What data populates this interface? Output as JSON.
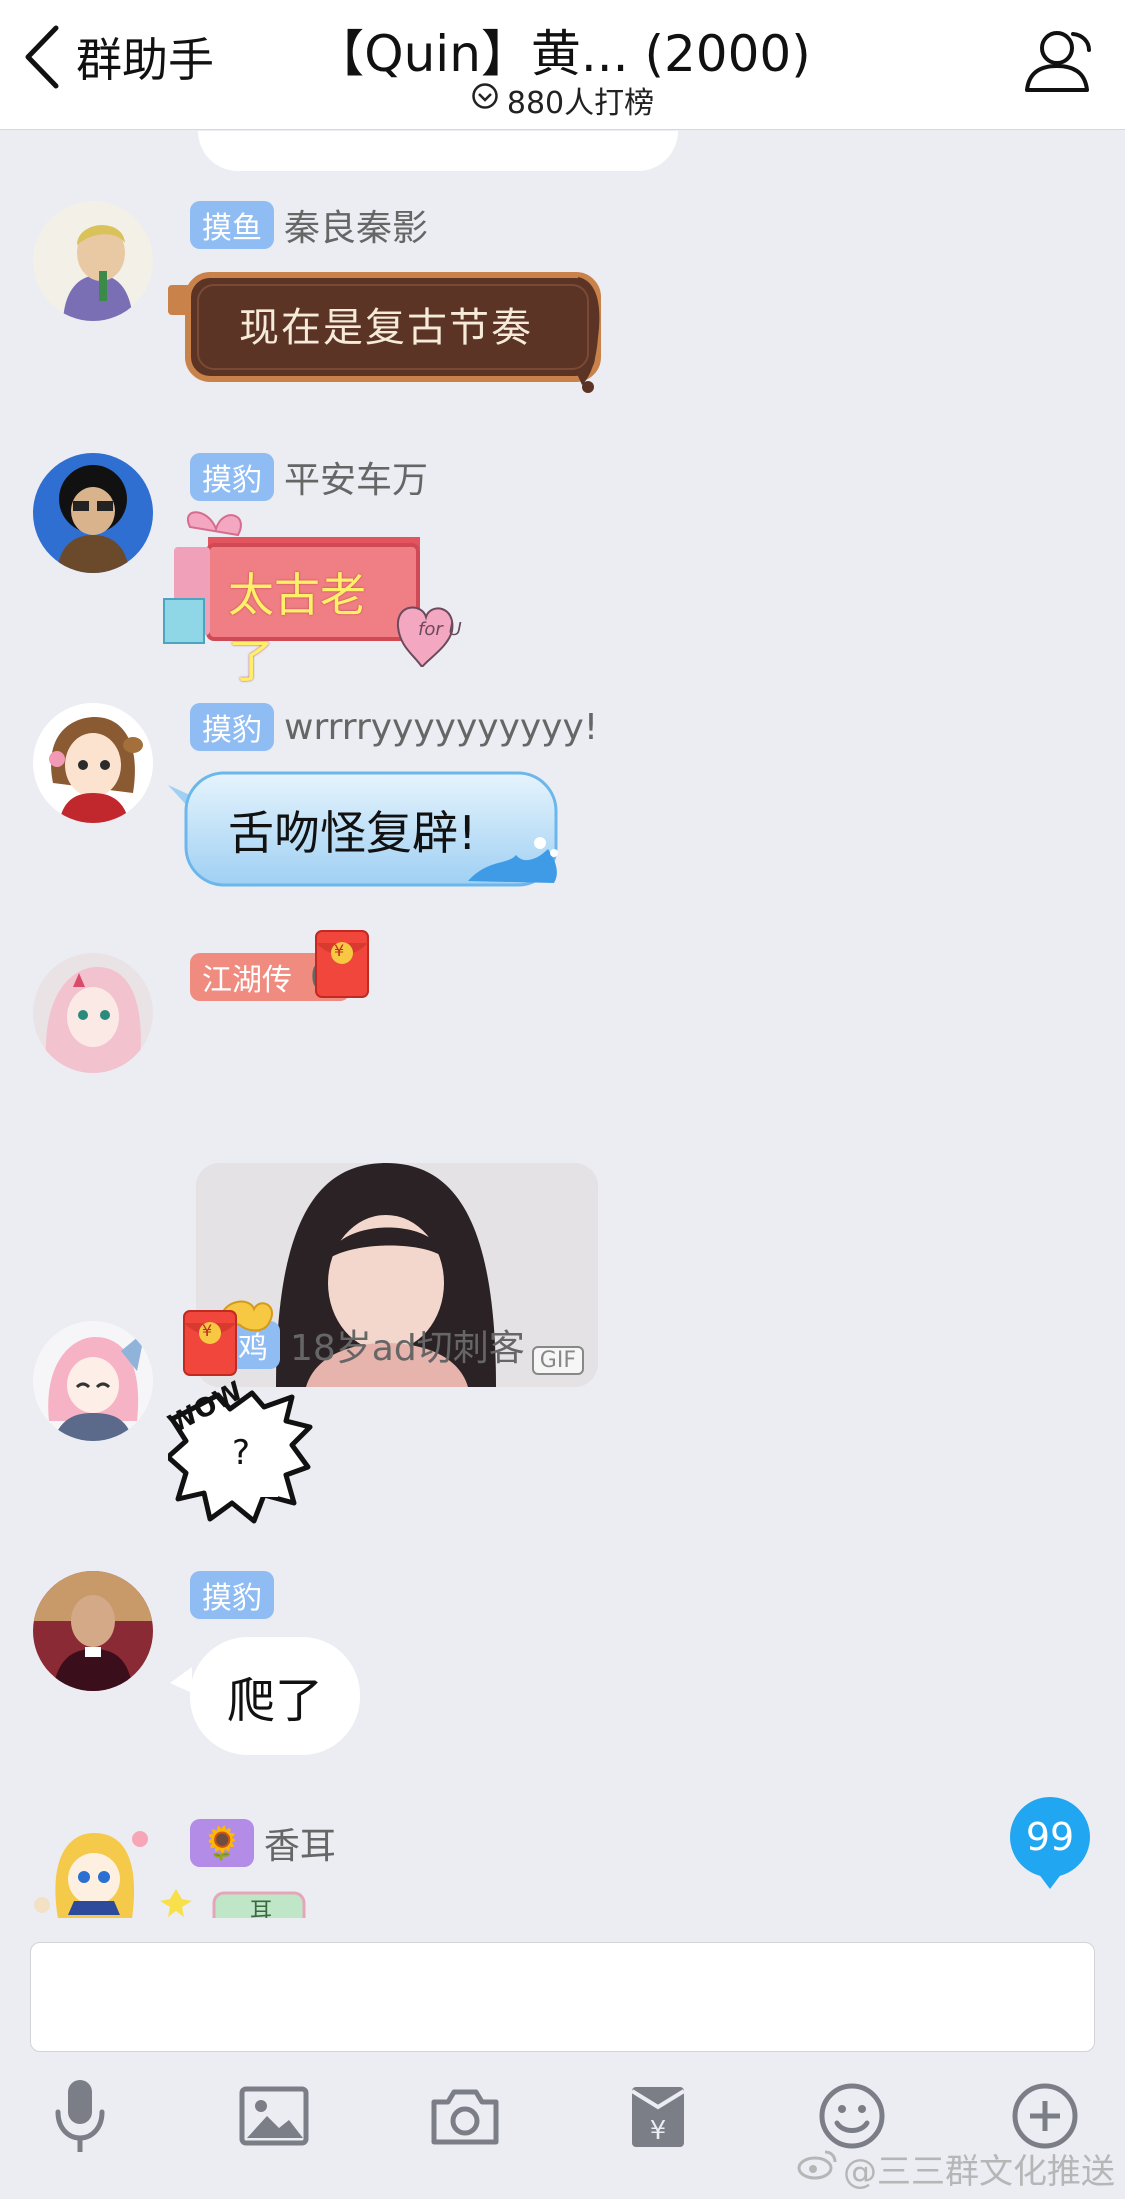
{
  "header": {
    "back_label": "群助手",
    "title": "【Quin】黄... (2000)",
    "subtitle": "880人打榜"
  },
  "messages": [
    {
      "badge": "摸鱼",
      "sender": "秦良秦影",
      "sticker_text": "现在是复古节奏"
    },
    {
      "badge": "摸豹",
      "sender": "平安车万",
      "sticker_text": "太古老了",
      "sticker_tag": "for U"
    },
    {
      "badge": "摸豹",
      "sender": "wrrrryyyyyyyyyy!",
      "sticker_text": "舌吻怪复辟!"
    },
    {
      "badge": "江湖传",
      "sender": "02",
      "gif_label": "GIF",
      "redpacket_symbol": "¥"
    },
    {
      "badge": "鸡",
      "sender": "18岁ad切刺客",
      "sticker_text": "WOW",
      "sticker_mark": "?",
      "redpacket_symbol": "¥"
    },
    {
      "badge": "摸豹",
      "sender": "",
      "text": "爬了"
    },
    {
      "badge": "🌻",
      "sender": "香耳",
      "partial_text": "耳"
    }
  ],
  "unread_count": "99",
  "input": {
    "placeholder": ""
  },
  "toolbar": [
    "microphone-icon",
    "image-icon",
    "camera-icon",
    "red-packet-icon",
    "emoji-icon",
    "plus-icon"
  ],
  "watermark": "@三三群文化推送",
  "colors": {
    "accent": "#21a6f1",
    "badge_blue": "#8ebcf3",
    "badge_red": "#f08b80",
    "background": "#ebedf3"
  }
}
